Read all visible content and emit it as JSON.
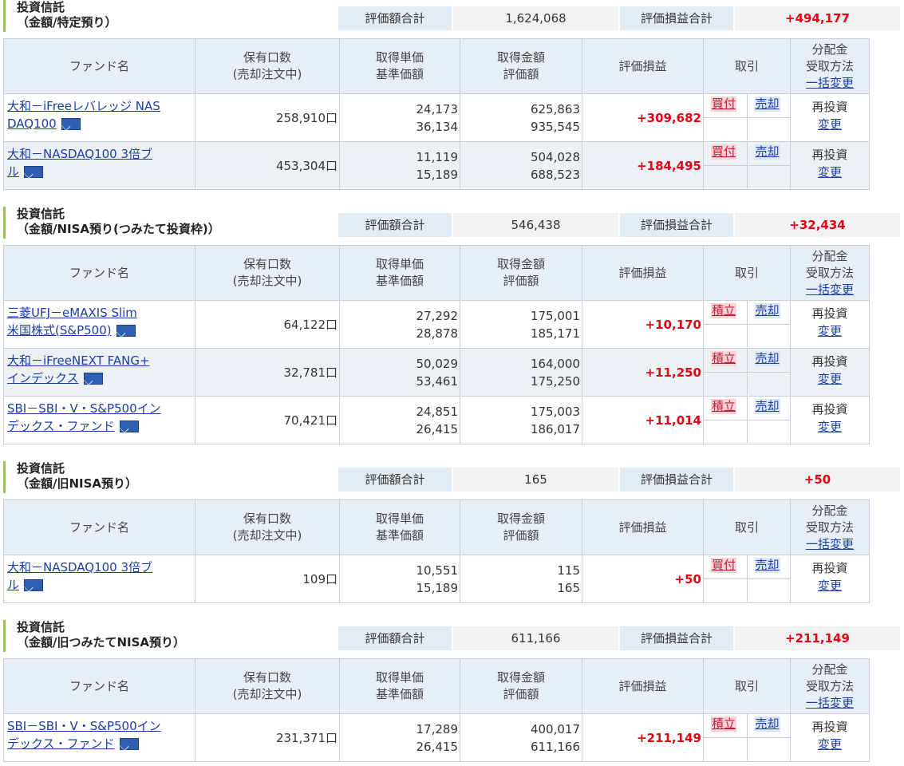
{
  "common": {
    "sum_label": "評価額合計",
    "pl_label": "評価損益合計",
    "headers": {
      "fund": "ファンド名",
      "units_1": "保有口数",
      "units_2": "(売却注文中)",
      "price_1": "取得単価",
      "price_2": "基準価額",
      "amount_1": "取得金額",
      "amount_2": "評価額",
      "pl": "評価損益",
      "trade": "取引",
      "dist_1": "分配金",
      "dist_2": "受取方法",
      "dist_3": "一括変更"
    },
    "sell": "売却",
    "reinvest": "再投資",
    "change": "変更"
  },
  "sections": [
    {
      "title_1": "投資信託",
      "title_2": "（金額/特定預り）",
      "total": "1,624,068",
      "pl_total": "+494,177",
      "funds": [
        {
          "name_1": "大和－iFreeレバレッジ NAS",
          "name_2": "DAQ100",
          "units": "258,910口",
          "cost_price": "24,173",
          "nav": "36,134",
          "cost_amount": "625,863",
          "value": "935,545",
          "pl": "+309,682",
          "buy": "買付"
        },
        {
          "name_1": "大和－NASDAQ100 3倍ブ",
          "name_2": "ル",
          "units": "453,304口",
          "cost_price": "11,119",
          "nav": "15,189",
          "cost_amount": "504,028",
          "value": "688,523",
          "pl": "+184,495",
          "buy": "買付"
        }
      ]
    },
    {
      "title_1": "投資信託",
      "title_2": "（金額/NISA預り(つみたて投資枠)）",
      "total": "546,438",
      "pl_total": "+32,434",
      "funds": [
        {
          "name_1": "三菱UFJ－eMAXIS Slim",
          "name_2": "米国株式(S&P500)",
          "units": "64,122口",
          "cost_price": "27,292",
          "nav": "28,878",
          "cost_amount": "175,001",
          "value": "185,171",
          "pl": "+10,170",
          "buy": "積立"
        },
        {
          "name_1": "大和－iFreeNEXT FANG+",
          "name_2": "インデックス",
          "units": "32,781口",
          "cost_price": "50,029",
          "nav": "53,461",
          "cost_amount": "164,000",
          "value": "175,250",
          "pl": "+11,250",
          "buy": "積立"
        },
        {
          "name_1": "SBI－SBI・V・S&P500イン",
          "name_2": "デックス・ファンド",
          "units": "70,421口",
          "cost_price": "24,851",
          "nav": "26,415",
          "cost_amount": "175,003",
          "value": "186,017",
          "pl": "+11,014",
          "buy": "積立"
        }
      ]
    },
    {
      "title_1": "投資信託",
      "title_2": "（金額/旧NISA預り）",
      "total": "165",
      "pl_total": "+50",
      "funds": [
        {
          "name_1": "大和－NASDAQ100 3倍ブ",
          "name_2": "ル",
          "units": "109口",
          "cost_price": "10,551",
          "nav": "15,189",
          "cost_amount": "115",
          "value": "165",
          "pl": "+50",
          "buy": "買付"
        }
      ]
    },
    {
      "title_1": "投資信託",
      "title_2": "（金額/旧つみたてNISA預り）",
      "total": "611,166",
      "pl_total": "+211,149",
      "funds": [
        {
          "name_1": "SBI－SBI・V・S&P500イン",
          "name_2": "デックス・ファンド",
          "units": "231,371口",
          "cost_price": "17,289",
          "nav": "26,415",
          "cost_amount": "400,017",
          "value": "611,166",
          "pl": "+211,149",
          "buy": "積立"
        }
      ]
    }
  ]
}
